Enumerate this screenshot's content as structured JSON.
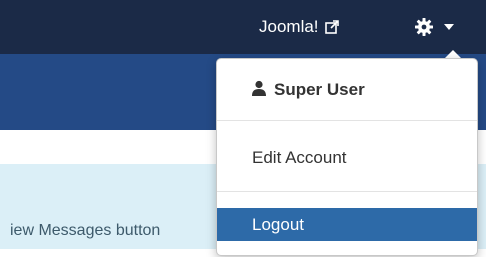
{
  "topbar": {
    "site_link": {
      "label": "Joomla!",
      "icon": "external-link-icon"
    },
    "settings_toggle": {
      "icon": "gear-icon",
      "caret": "caret-down-icon"
    }
  },
  "message_strip": {
    "text": "iew Messages button"
  },
  "user_menu": {
    "header": {
      "icon": "user-icon",
      "label": "Super User"
    },
    "items": [
      {
        "label": "Edit Account",
        "active": false
      },
      {
        "label": "Logout",
        "active": true
      }
    ]
  },
  "colors": {
    "topbar_bg": "#1b2a47",
    "subbar_bg": "#244a86",
    "message_bg": "#dbeff7",
    "active_item_bg": "#2d6aa8"
  }
}
